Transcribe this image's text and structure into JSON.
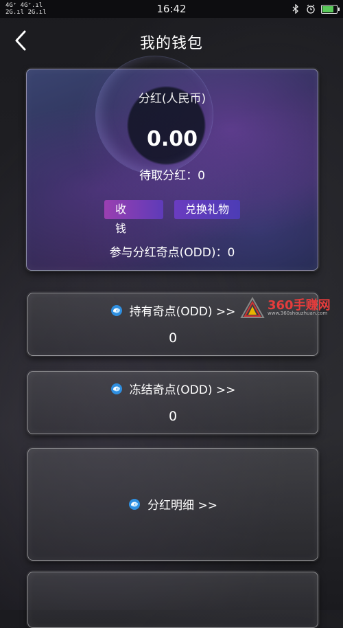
{
  "status_bar": {
    "network_row1": "4G⁺ 4G⁺.ıl",
    "network_row2": "2G.ıl 2G.ıl",
    "time": "16:42",
    "icons": [
      "bluetooth-icon",
      "alarm-icon",
      "battery-icon"
    ]
  },
  "header": {
    "title": "我的钱包",
    "back_icon": "chevron-left-icon"
  },
  "dividend_card": {
    "label": "分红(人民币)",
    "amount": "0.00",
    "pending": "待取分红：0",
    "collect_button": "收 钱",
    "exchange_button": "兑换礼物",
    "participate": "参与分红奇点(ODD)：0",
    "colors": {
      "button_start": "#9a3fb1",
      "button_end": "#5e3bb8"
    }
  },
  "holdings": {
    "title": "持有奇点(ODD)  >>",
    "value": "0"
  },
  "frozen": {
    "title": "冻结奇点(ODD)  >>",
    "value": "0"
  },
  "details": {
    "title": "分红明细  >>"
  },
  "watermark": {
    "brand": "360手赚网",
    "url": "www.360shouzhuan.com"
  }
}
